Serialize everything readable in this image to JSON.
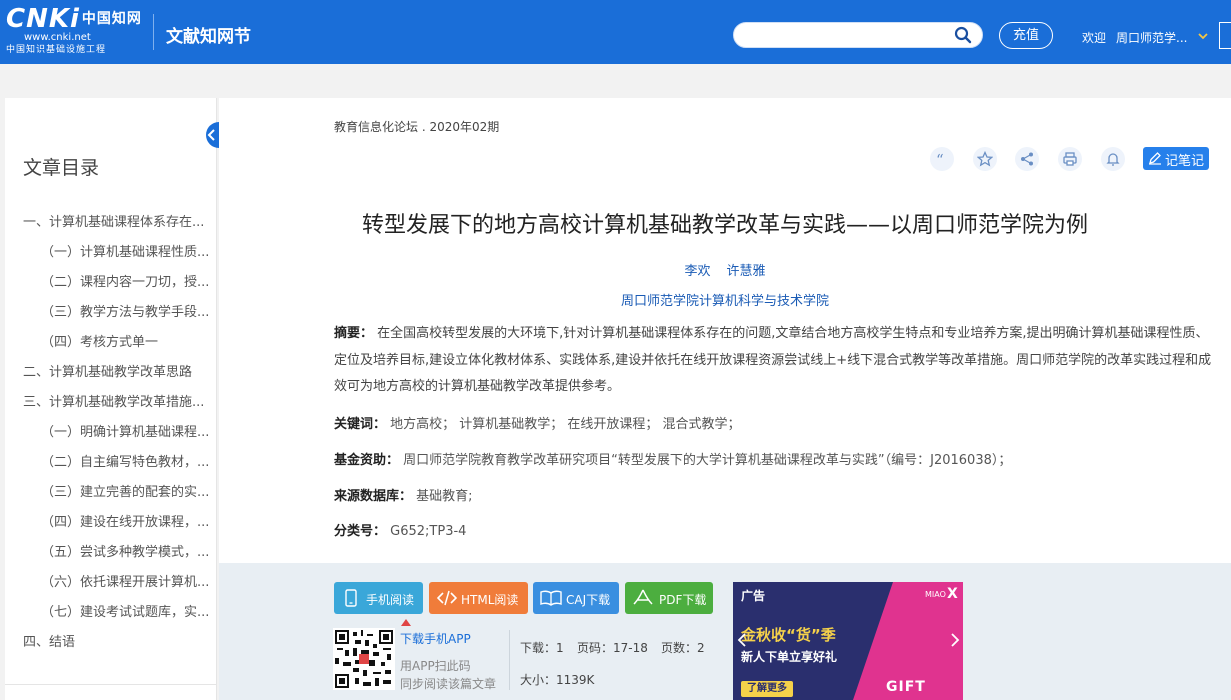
{
  "header": {
    "logo_main": "CNKi",
    "logo_cn": "中国知网",
    "logo_url": "www.cnki.net",
    "logo_sub": "中国知识基础设施工程",
    "site_name": "文献知网节",
    "search_placeholder": "",
    "recharge_label": "充值",
    "welcome_label": "欢迎",
    "user_name": "周口师范学..."
  },
  "toc": {
    "title": "文章目录",
    "items": [
      {
        "label": "一、计算机基础课程体系存在...",
        "level": 1
      },
      {
        "label": "（一）计算机基础课程性质...",
        "level": 2
      },
      {
        "label": "（二）课程内容一刀切，授...",
        "level": 2
      },
      {
        "label": "（三）教学方法与教学手段...",
        "level": 2
      },
      {
        "label": "（四）考核方式单一",
        "level": 2
      },
      {
        "label": "二、计算机基础教学改革思路",
        "level": 1
      },
      {
        "label": "三、计算机基础教学改革措施...",
        "level": 1
      },
      {
        "label": "（一）明确计算机基础课程...",
        "level": 2
      },
      {
        "label": "（二）自主编写特色教材，...",
        "level": 2
      },
      {
        "label": "（三）建立完善的配套的实...",
        "level": 2
      },
      {
        "label": "（四）建设在线开放课程，...",
        "level": 2
      },
      {
        "label": "（五）尝试多种教学模式，...",
        "level": 2
      },
      {
        "label": "（六）依托课程开展计算机...",
        "level": 2
      },
      {
        "label": "（七）建设考试试题库，实...",
        "level": 2
      },
      {
        "label": "四、结语",
        "level": 1
      }
    ]
  },
  "article": {
    "journal": "教育信息化论坛 . 2020年02期",
    "note_label": "记笔记",
    "title": "转型发展下的地方高校计算机基础教学改革与实践——以周口师范学院为例",
    "authors": [
      "李欢",
      "许慧雅"
    ],
    "affiliation": "周口师范学院计算机科学与技术学院",
    "abstract_label": "摘要：",
    "abstract": "在全国高校转型发展的大环境下,针对计算机基础课程体系存在的问题,文章结合地方高校学生特点和专业培养方案,提出明确计算机基础课程性质、定位及培养目标,建设立体化教材体系、实践体系,建设并依托在线开放课程资源尝试线上+线下混合式教学等改革措施。周口师范学院的改革实践过程和成效可为地方高校的计算机基础教学改革提供参考。",
    "keywords_label": "关键词：",
    "keywords": "地方高校；  计算机基础教学；  在线开放课程；  混合式教学；",
    "fund_label": "基金资助：",
    "fund": "周口师范学院教育教学改革研究项目“转型发展下的大学计算机基础课程改革与实践”（编号：J2016038）；",
    "source_label": "来源数据库：",
    "source": "基础教育;",
    "class_label": "分类号：",
    "class": "G652;TP3-4"
  },
  "download": {
    "mobile_read": "手机阅读",
    "html_read": "HTML阅读",
    "caj_download": "CAJ下载",
    "pdf_download": "PDF下载",
    "app_link": "下载手机APP",
    "app_hint1": "用APP扫此码",
    "app_hint2": "同步阅读该篇文章",
    "downloads": "下载：1",
    "pages_range": "页码：17-18",
    "page_count": "页数：2",
    "size": "大小：1139K"
  },
  "ad": {
    "label": "广告",
    "headline": "金秋收“货”季",
    "subline": "新人下单立享好礼",
    "button": "了解更多",
    "brand": "MIAO",
    "close": "X",
    "gift": "GIFT"
  },
  "colors": {
    "header_bg": "#1a6ed8",
    "mobile_btn": "#3aa7d9",
    "html_btn": "#f07c3a",
    "caj_btn": "#3a8fe0",
    "pdf_btn": "#4cae3f"
  },
  "icons": [
    "search-icon",
    "chevron-down-icon",
    "collapse-arrow-icon",
    "quote-icon",
    "star-icon",
    "share-icon",
    "print-icon",
    "bell-icon",
    "edit-icon",
    "phone-icon",
    "code-icon",
    "book-icon",
    "pdf-icon",
    "qr-code-icon"
  ]
}
